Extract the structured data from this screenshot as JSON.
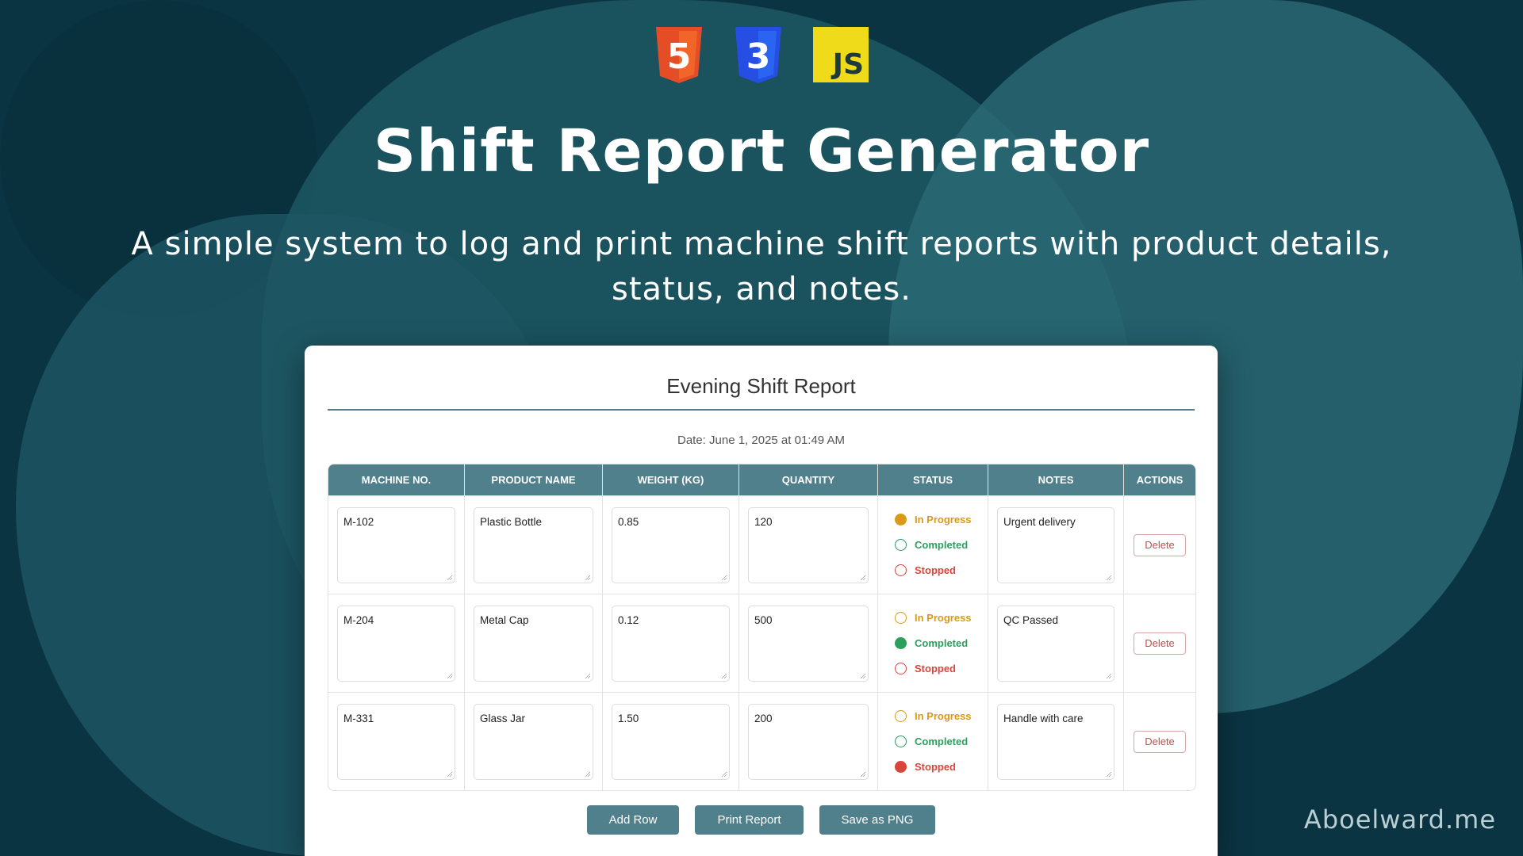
{
  "logos": {
    "html": "5",
    "css": "3",
    "js": "JS"
  },
  "title": "Shift Report Generator",
  "subtitle": "A simple system to log and print machine shift reports with product details, status, and notes.",
  "report": {
    "title": "Evening Shift Report",
    "date": "Date: June 1, 2025 at 01:49 AM",
    "columns": [
      "MACHINE NO.",
      "PRODUCT NAME",
      "WEIGHT (KG)",
      "QUANTITY",
      "STATUS",
      "NOTES",
      "ACTIONS"
    ],
    "status_options": [
      "In Progress",
      "Completed",
      "Stopped"
    ],
    "rows": [
      {
        "machine": "M-102",
        "product": "Plastic Bottle",
        "weight": "0.85",
        "quantity": "120",
        "status": "In Progress",
        "notes": "Urgent delivery",
        "action": "Delete"
      },
      {
        "machine": "M-204",
        "product": "Metal Cap",
        "weight": "0.12",
        "quantity": "500",
        "status": "Completed",
        "notes": "QC Passed",
        "action": "Delete"
      },
      {
        "machine": "M-331",
        "product": "Glass Jar",
        "weight": "1.50",
        "quantity": "200",
        "status": "Stopped",
        "notes": "Handle with care",
        "action": "Delete"
      }
    ]
  },
  "buttons": {
    "add": "Add Row",
    "print": "Print Report",
    "save": "Save as PNG"
  },
  "watermark": "Aboelward.me",
  "colors": {
    "in_progress": "#d99a1a",
    "completed": "#2e9e5e",
    "stopped": "#d9453b",
    "header": "#50808c"
  }
}
